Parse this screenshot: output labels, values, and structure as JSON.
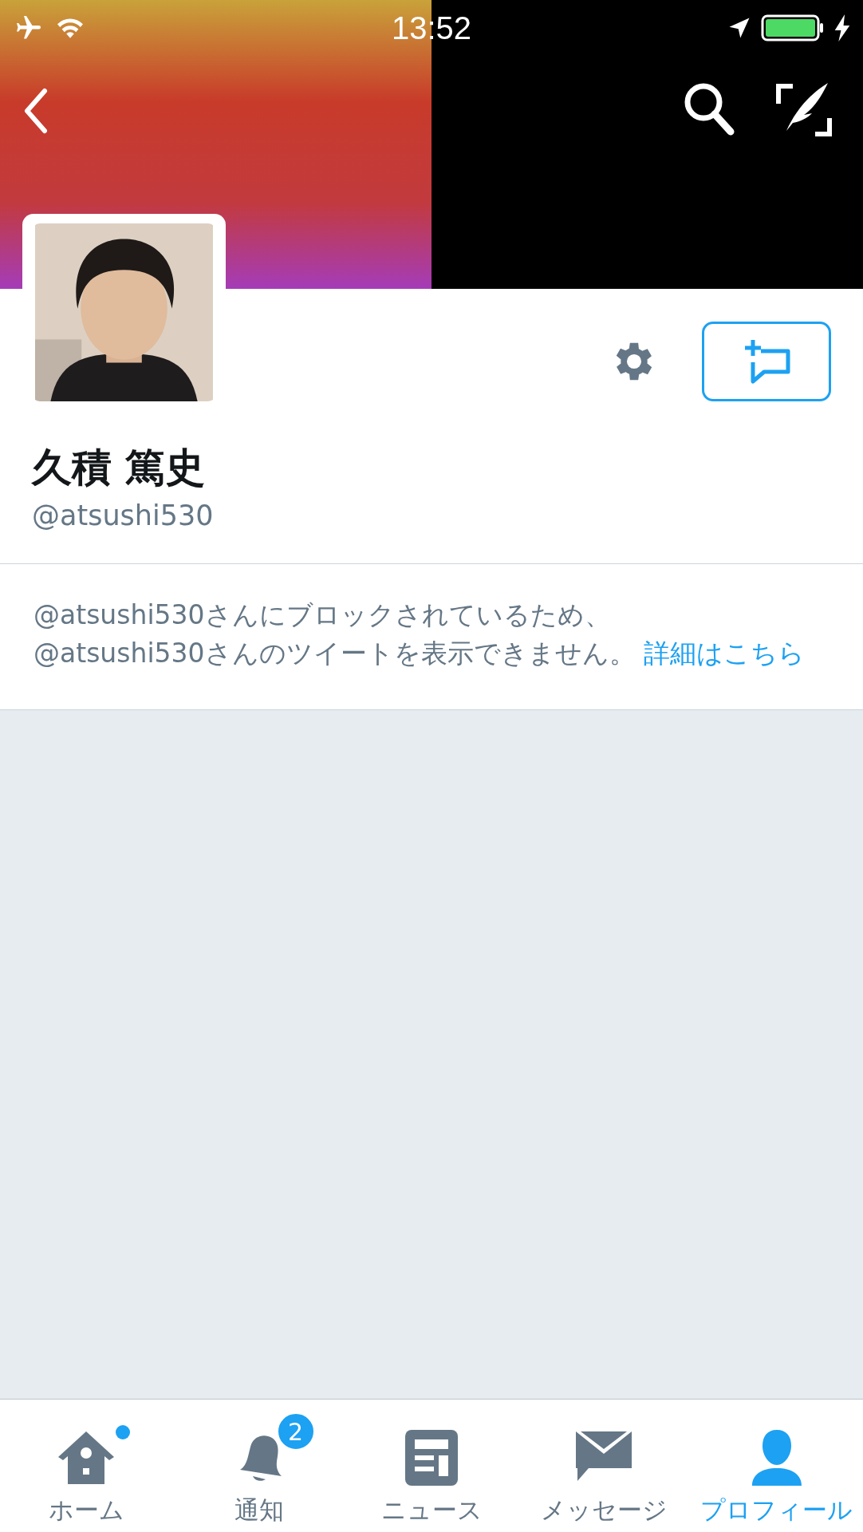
{
  "status_bar": {
    "time": "13:52",
    "charging": true
  },
  "profile": {
    "name": "久積 篤史",
    "handle": "@atsushi530"
  },
  "blocked_notice": {
    "text": "@atsushi530さんにブロックされているため、\n@atsushi530さんのツイートを表示できません。",
    "link": "詳細はこちら"
  },
  "tabs": [
    {
      "label": "ホーム",
      "kind": "home",
      "selected": false,
      "dot": true
    },
    {
      "label": "通知",
      "kind": "notifications",
      "selected": false,
      "badge": "2"
    },
    {
      "label": "ニュース",
      "kind": "news",
      "selected": false
    },
    {
      "label": "メッセージ",
      "kind": "messages",
      "selected": false
    },
    {
      "label": "プロフィール",
      "kind": "profile",
      "selected": true
    }
  ]
}
